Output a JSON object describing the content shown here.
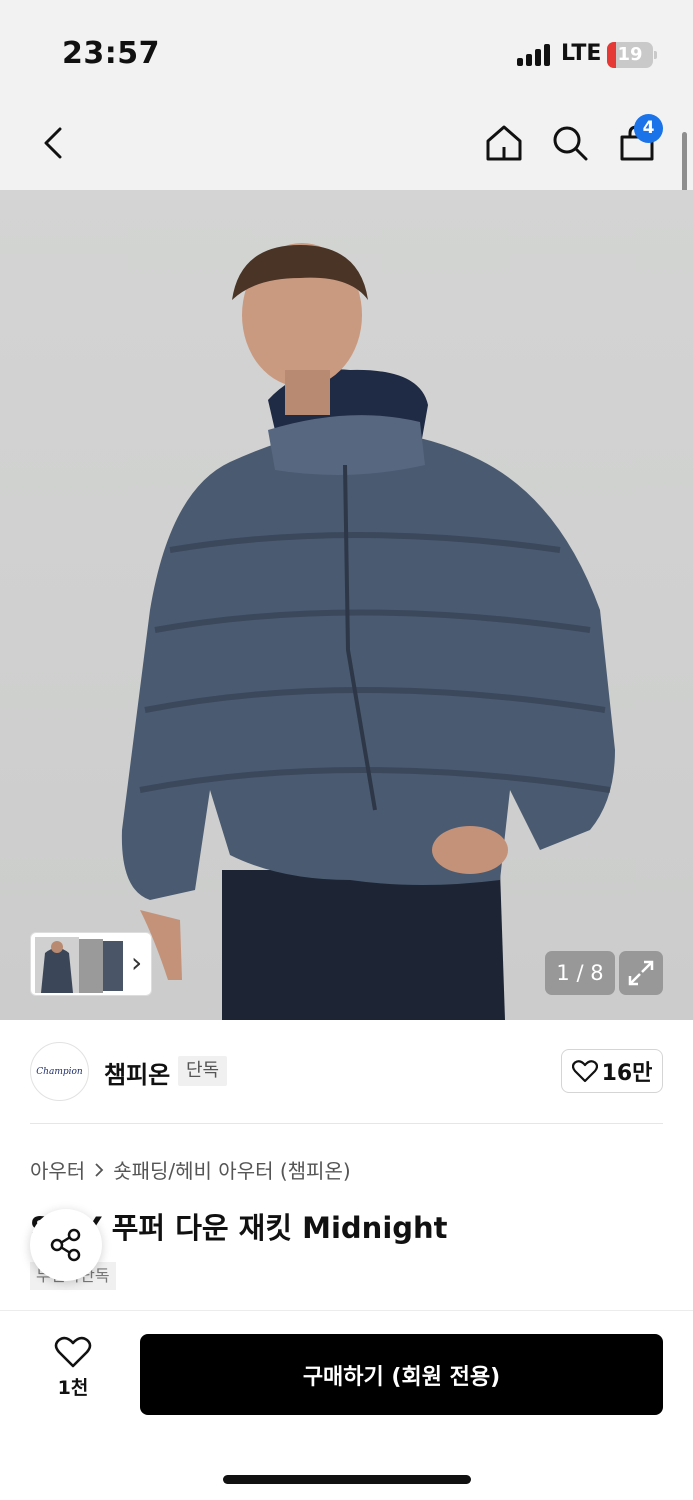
{
  "status_bar": {
    "time": "23:57",
    "network": "LTE",
    "battery_level": "19",
    "battery_fraction": 0.19
  },
  "nav": {
    "back_icon": "chevron-left-icon",
    "home_icon": "home-icon",
    "search_icon": "search-icon",
    "cart_icon": "shopping-bag-icon",
    "cart_count": "4"
  },
  "gallery": {
    "counter": "1 / 8",
    "expand_icon": "expand-icon",
    "thumb_arrow": "›"
  },
  "brand": {
    "logo_text": "Champion",
    "name": "챔피온",
    "tag": "단독",
    "likes": "16만"
  },
  "product": {
    "category": "아우터",
    "subcategory": "숏패딩/헤비 아우터 (챔피온)",
    "title": "S    AY 푸퍼 다운 재킷 Midnight",
    "title_tag": "무신사단독"
  },
  "bottom": {
    "wish_count": "1천",
    "buy_label": "구매하기 (회원 전용)"
  },
  "colors": {
    "accent_badge": "#1a73e8",
    "battery_low": "#e53935",
    "buy_button": "#000000"
  }
}
